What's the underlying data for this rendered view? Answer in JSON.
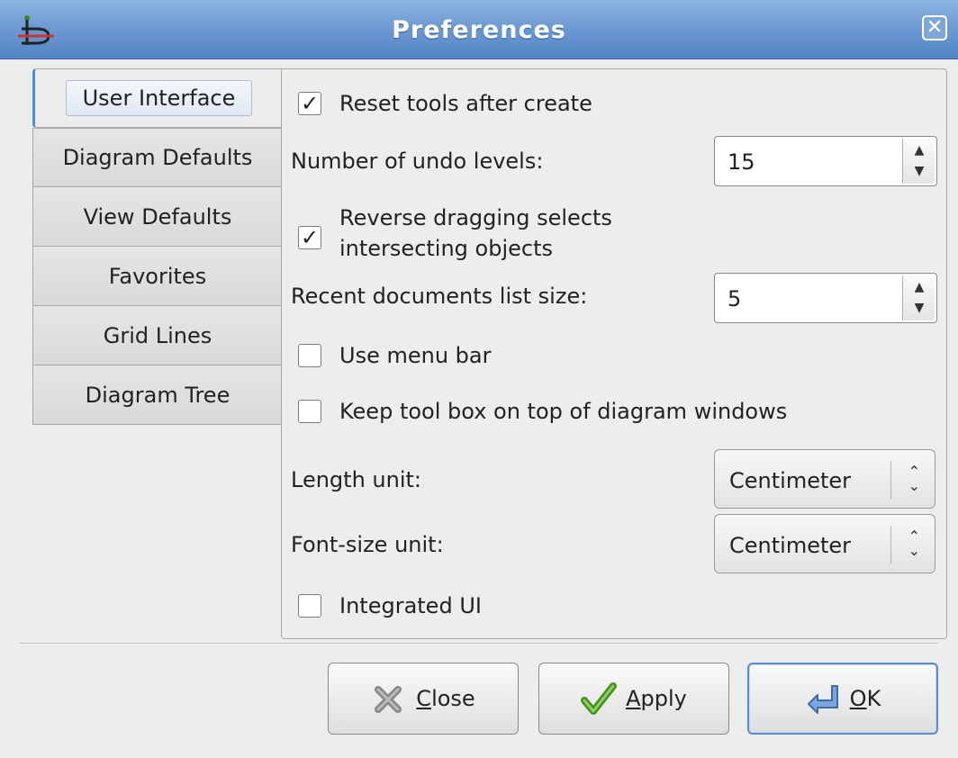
{
  "window": {
    "title": "Preferences"
  },
  "tabs": [
    {
      "label": "User Interface",
      "active": true
    },
    {
      "label": "Diagram Defaults",
      "active": false
    },
    {
      "label": "View Defaults",
      "active": false
    },
    {
      "label": "Favorites",
      "active": false
    },
    {
      "label": "Grid Lines",
      "active": false
    },
    {
      "label": "Diagram Tree",
      "active": false
    }
  ],
  "settings": {
    "reset_tools": {
      "label": "Reset tools after create",
      "checked": true
    },
    "undo_levels": {
      "label": "Number of undo levels:",
      "value": "15"
    },
    "reverse_dragging": {
      "label_line1": "Reverse dragging selects",
      "label_line2": "intersecting objects",
      "checked": true
    },
    "recent_docs": {
      "label": "Recent documents list size:",
      "value": "5"
    },
    "use_menu_bar": {
      "label": "Use menu bar",
      "checked": false
    },
    "keep_toolbox": {
      "label": "Keep tool box on top of diagram windows",
      "checked": false
    },
    "length_unit": {
      "label": "Length unit:",
      "value": "Centimeter"
    },
    "font_size_unit": {
      "label": "Font-size unit:",
      "value": "Centimeter"
    },
    "integrated_ui": {
      "label": "Integrated UI",
      "checked": false
    }
  },
  "buttons": {
    "close": {
      "mnemonic": "C",
      "rest": "lose"
    },
    "apply": {
      "mnemonic": "A",
      "rest": "pply"
    },
    "ok": {
      "mnemonic": "O",
      "rest": "K"
    }
  },
  "glyphs": {
    "check": "✓",
    "spin_up": "▲",
    "spin_down": "▼",
    "combo_up": "⌃",
    "combo_down": "⌄",
    "close_x": "✕"
  },
  "colors": {
    "titlebar": "#6d9bd3",
    "accent": "#5a8bd0",
    "window_bg": "#ededed"
  }
}
